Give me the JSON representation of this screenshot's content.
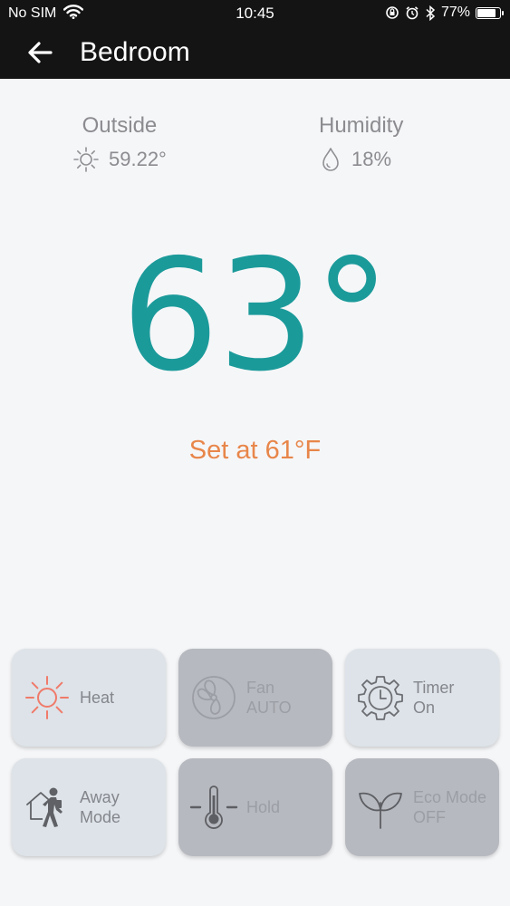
{
  "status_bar": {
    "carrier": "No SIM",
    "time": "10:45",
    "battery_text": "77%",
    "battery_level": 0.77
  },
  "header": {
    "title": "Bedroom",
    "back_icon": "back-arrow-icon"
  },
  "outside": {
    "label": "Outside",
    "value": "59.22°",
    "icon": "sun-icon"
  },
  "humidity": {
    "label": "Humidity",
    "value": "18%",
    "icon": "drop-icon"
  },
  "current_temp": "63°",
  "set_point": "Set at 61°F",
  "colors": {
    "temp": "#1b9a9a",
    "set_point": "#e8864a",
    "heat_icon": "#f07a6a",
    "header_bg": "#141414"
  },
  "tiles": {
    "heat": {
      "line1": "Heat",
      "line2": "",
      "icon": "heat-sun-icon",
      "active": true
    },
    "fan": {
      "line1": "Fan",
      "line2": "AUTO",
      "icon": "fan-icon",
      "active": false
    },
    "timer": {
      "line1": "Timer",
      "line2": "On",
      "icon": "timer-gear-icon",
      "active": true
    },
    "away": {
      "line1": "Away",
      "line2": "Mode",
      "icon": "away-person-icon",
      "active": true
    },
    "hold": {
      "line1": "Hold",
      "line2": "",
      "icon": "thermometer-icon",
      "active": false
    },
    "eco": {
      "line1": "Eco Mode",
      "line2": "OFF",
      "icon": "leaf-icon",
      "active": false
    }
  }
}
